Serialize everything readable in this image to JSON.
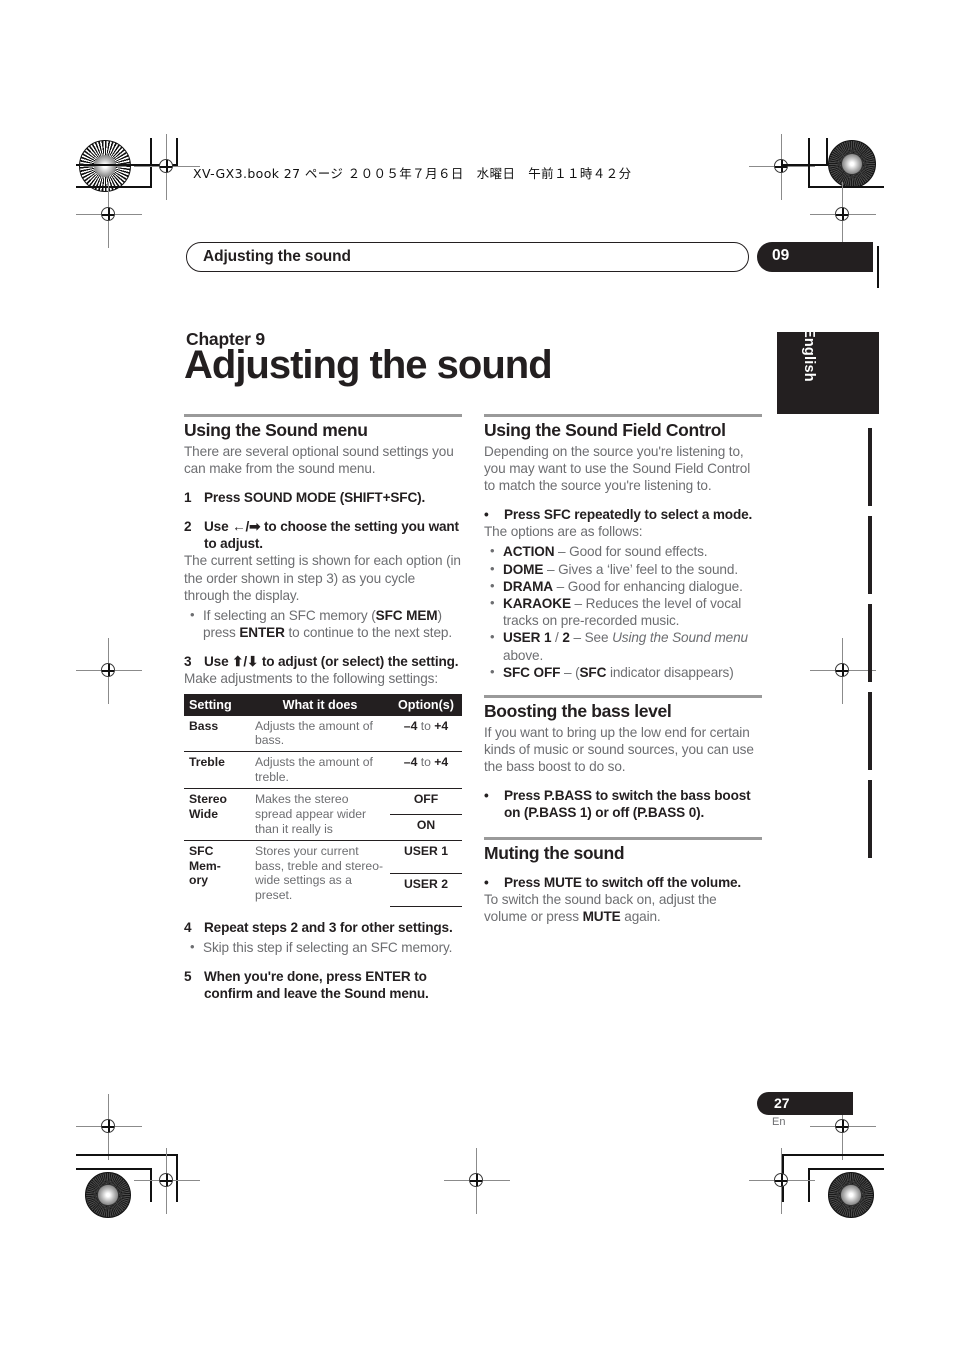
{
  "print_marks": {
    "doc_stamp": "XV-GX3.book 27 ページ ２００５年７月６日　水曜日　午前１１時４２分"
  },
  "running_header": {
    "title": "Adjusting the sound",
    "chapter_number": "09"
  },
  "language_tab": {
    "label": "English"
  },
  "chapter": {
    "label": "Chapter 9",
    "title": "Adjusting the sound"
  },
  "left_column": {
    "sound_menu": {
      "heading": "Using the Sound menu",
      "intro": "There are several optional sound settings you can make from the sound menu.",
      "steps": [
        {
          "number": "1",
          "text": "Press SOUND MODE (SHIFT+SFC)."
        },
        {
          "number": "2",
          "text": "Use ←/➡ to choose the setting you want to adjust.",
          "body": "The current setting is shown for each option (in the order shown in step 3) as you cycle through the display.",
          "bullets": [
            "If selecting an SFC memory (SFC MEM) press ENTER to continue to the next step."
          ]
        },
        {
          "number": "3",
          "text": "Use ⬆/⬇ to adjust (or select) the setting.",
          "body": "Make adjustments to the following settings:"
        },
        {
          "number": "4",
          "text": "Repeat steps 2 and 3 for other settings.",
          "bullets": [
            "Skip this step if selecting an SFC memory."
          ]
        },
        {
          "number": "5",
          "text": "When you're done, press ENTER to confirm and leave the Sound menu."
        }
      ],
      "table": {
        "headers": [
          "Setting",
          "What it does",
          "Option(s)"
        ],
        "rows": [
          {
            "setting": "Bass",
            "description": "Adjusts the amount of bass.",
            "options": [
              "–4 to +4"
            ]
          },
          {
            "setting": "Treble",
            "description": "Adjusts the amount of treble.",
            "options": [
              "–4 to +4"
            ]
          },
          {
            "setting": "Stereo Wide",
            "description": "Makes the stereo spread appear wider than it really is",
            "options": [
              "OFF",
              "ON"
            ]
          },
          {
            "setting": "SFC Memory",
            "description": "Stores your current bass, treble and stereo-wide settings as a preset.",
            "options": [
              "USER 1",
              "USER 2"
            ]
          }
        ]
      }
    }
  },
  "right_column": {
    "sound_field_control": {
      "heading": "Using the Sound Field Control",
      "intro": "Depending on the source you're listening to, you may want to use the Sound Field Control to match the source you're listening to.",
      "instruction": "Press SFC repeatedly to select a mode.",
      "instruction_body": "The options are as follows:",
      "modes": [
        {
          "name": "ACTION",
          "desc": "– Good for sound effects."
        },
        {
          "name": "DOME",
          "desc": "– Gives a 'live' feel to the sound."
        },
        {
          "name": "DRAMA",
          "desc": "– Good for enhancing dialogue."
        },
        {
          "name": "KARAOKE",
          "desc": "– Reduces the level of vocal tracks on pre-recorded music."
        },
        {
          "name": "USER 1 / 2",
          "desc": "– See Using the Sound menu above."
        },
        {
          "name": "SFC OFF",
          "desc": "– (SFC indicator disappears)"
        }
      ]
    },
    "bass_boost": {
      "heading": "Boosting the bass level",
      "intro": "If you want to bring up the low end for certain kinds of music or sound sources, you can use the bass boost to do so.",
      "instruction": "Press P.BASS to switch the bass boost on (P.BASS 1) or off (P.BASS 0)."
    },
    "muting": {
      "heading": "Muting the sound",
      "instruction": "Press MUTE to switch off the volume.",
      "body": "To switch the sound back on, adjust the volume or press MUTE again."
    }
  },
  "footer": {
    "page_number": "27",
    "language_code": "En"
  },
  "colors": {
    "ink": "#231f20",
    "body_text": "#6d6e71",
    "rule": "#9a9a9a"
  }
}
